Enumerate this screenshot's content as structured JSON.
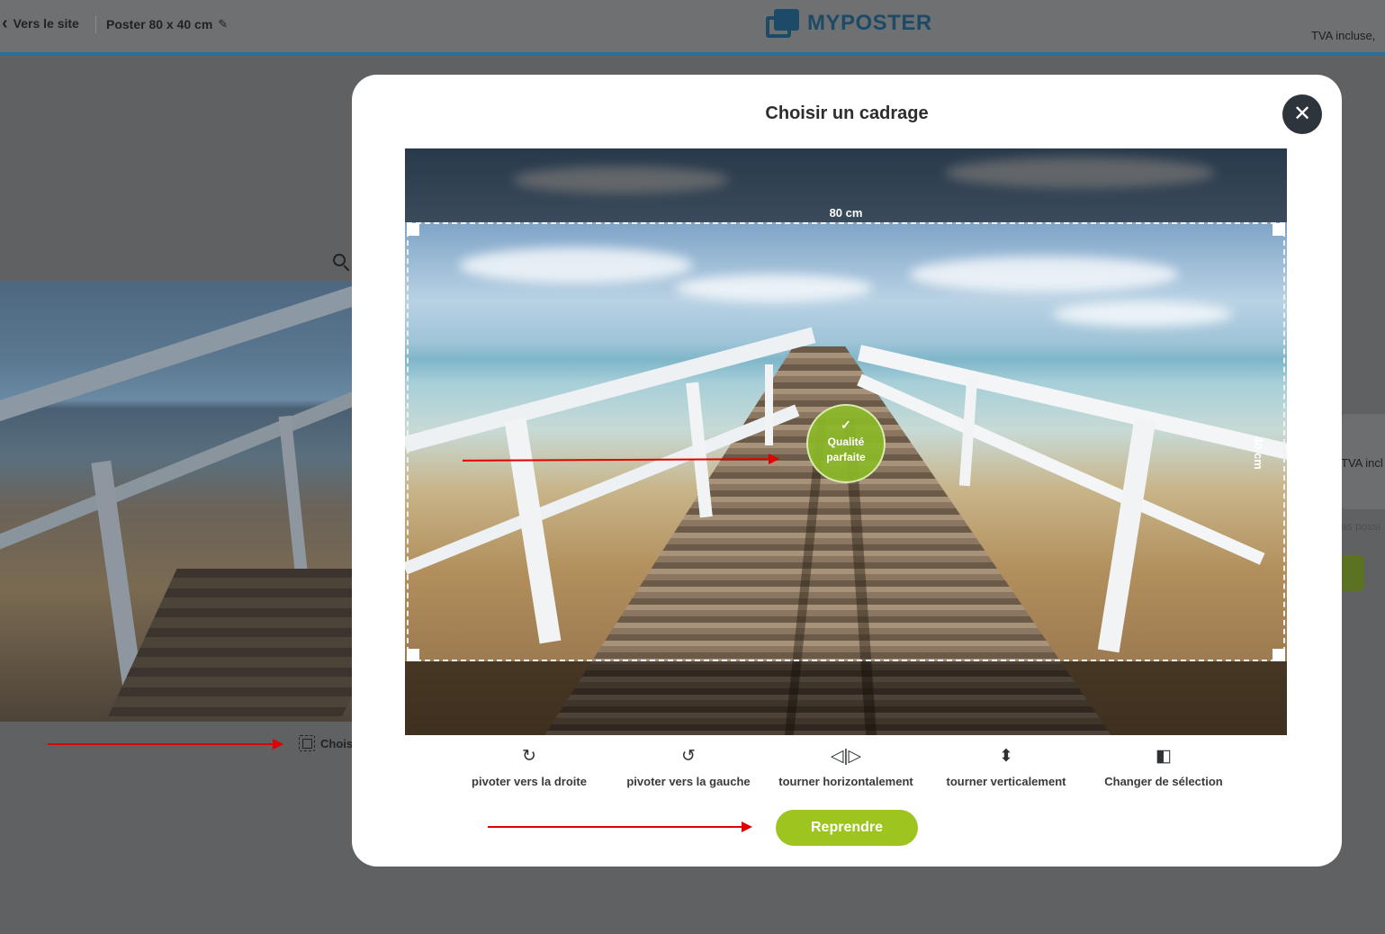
{
  "header": {
    "back_label": "Vers le site",
    "product_name": "Poster 80 x 40 cm",
    "logo_text": "MYPOSTER",
    "tva_label": "TVA incluse,"
  },
  "background": {
    "crop_link_label": "Chois",
    "side_tva_label": "TVA incl",
    "side_text_fragment": "as possi"
  },
  "modal": {
    "title": "Choisir un cadrage",
    "close_icon": "close-icon",
    "crop": {
      "width_label": "80 cm",
      "height_label": "40 cm",
      "quality_label_1": "Qualité",
      "quality_label_2": "parfaite"
    },
    "tools": [
      {
        "label": "pivoter vers la droite",
        "icon": "rotate-right-icon"
      },
      {
        "label": "pivoter vers la gauche",
        "icon": "rotate-left-icon"
      },
      {
        "label": "tourner horizontalement",
        "icon": "flip-horizontal-icon"
      },
      {
        "label": "tourner verticalement",
        "icon": "flip-vertical-icon"
      },
      {
        "label": "Changer de sélection",
        "icon": "change-selection-icon"
      }
    ],
    "primary_button": "Reprendre"
  },
  "colors": {
    "accent_green": "#9dc41f",
    "brand_blue": "#1d4a66",
    "annotation_red": "#e00000"
  }
}
